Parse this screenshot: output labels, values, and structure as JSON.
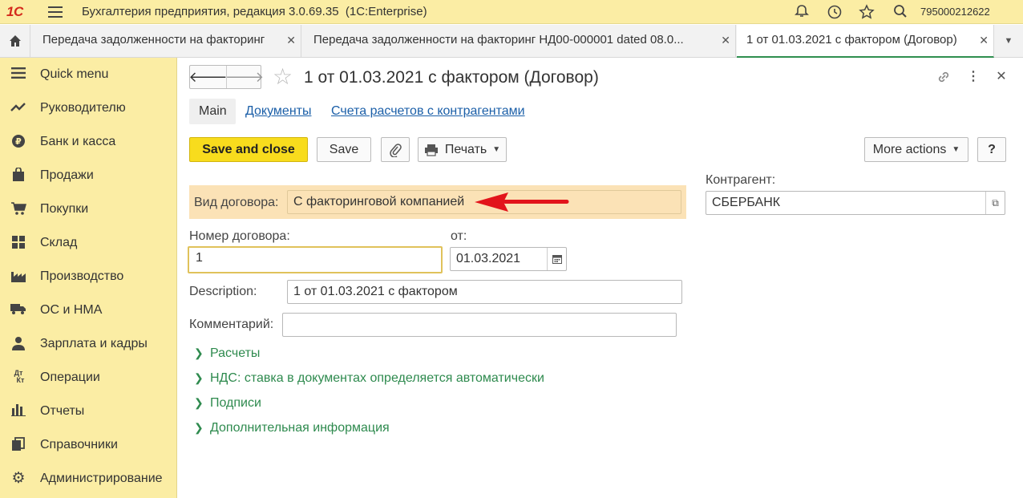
{
  "app": {
    "logo_text": "1С",
    "title": "Бухгалтерия предприятия, редакция 3.0.69.35",
    "platform": "(1С:Enterprise)",
    "user_id": "795000212622"
  },
  "tabs": [
    {
      "label": "Передача задолженности на факторинг",
      "active": false
    },
    {
      "label": "Передача задолженности на факторинг НД00-000001 dated 08.0...",
      "active": false
    },
    {
      "label": "1 от 01.03.2021 с фактором (Договор)",
      "active": true
    }
  ],
  "sidebar": {
    "items": [
      {
        "label": "Quick menu",
        "icon": "menu-icon"
      },
      {
        "label": "Руководителю",
        "icon": "trend-icon"
      },
      {
        "label": "Банк и касса",
        "icon": "ruble-coin-icon"
      },
      {
        "label": "Продажи",
        "icon": "bag-icon"
      },
      {
        "label": "Покупки",
        "icon": "cart-icon"
      },
      {
        "label": "Склад",
        "icon": "boxes-icon"
      },
      {
        "label": "Производство",
        "icon": "factory-icon"
      },
      {
        "label": "ОС и НМА",
        "icon": "truck-icon"
      },
      {
        "label": "Зарплата и кадры",
        "icon": "person-icon"
      },
      {
        "label": "Операции",
        "icon": "dt-kt-icon"
      },
      {
        "label": "Отчеты",
        "icon": "bar-chart-icon"
      },
      {
        "label": "Справочники",
        "icon": "books-icon"
      },
      {
        "label": "Администрирование",
        "icon": "gear-icon"
      }
    ]
  },
  "form": {
    "title": "1 от 01.03.2021 с фактором (Договор)",
    "subtabs": {
      "main": "Main",
      "documents": "Документы",
      "accounts": "Счета расчетов с контрагентами"
    },
    "toolbar": {
      "save_close": "Save and close",
      "save": "Save",
      "print": "Печать",
      "more_actions": "More actions",
      "help": "?"
    },
    "fields": {
      "contract_type_label": "Вид договора:",
      "contract_type_value": "С факторинговой компанией",
      "counterparty_label": "Контрагент:",
      "counterparty_value": "СБЕРБАНК",
      "number_label": "Номер договора:",
      "number_value": "1",
      "date_label": "от:",
      "date_value": "01.03.2021",
      "description_label": "Description:",
      "description_value": "1 от 01.03.2021 с фактором",
      "comment_label": "Комментарий:",
      "comment_value": ""
    },
    "sections": [
      "Расчеты",
      "НДС: ставка в документах определяется автоматически",
      "Подписи",
      "Дополнительная информация"
    ]
  },
  "colors": {
    "sidebar_bg": "#fbeda4",
    "primary_button": "#f8dc1d",
    "link": "#1b5fa8",
    "section_green": "#2e8a4e",
    "arrow_red": "#e2141b"
  }
}
